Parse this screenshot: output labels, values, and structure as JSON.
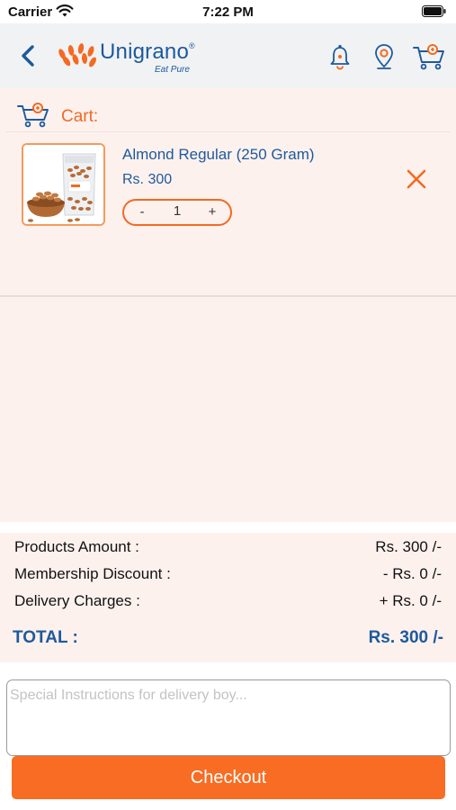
{
  "status_bar": {
    "carrier": "Carrier",
    "time": "7:22 PM"
  },
  "header": {
    "brand_name": "Unigrano",
    "brand_reg": "®",
    "brand_tagline": "Eat Pure",
    "icons": [
      "back-arrow-icon",
      "bell-icon",
      "location-pin-icon",
      "cart-icon"
    ]
  },
  "cart": {
    "title": "Cart:",
    "items": [
      {
        "name": "Almond Regular (250 Gram)",
        "price": "Rs. 300",
        "quantity": "1",
        "minus_label": "-",
        "plus_label": "+"
      }
    ]
  },
  "summary": {
    "products_amount_label": "Products Amount :",
    "products_amount_value": "Rs. 300 /-",
    "membership_discount_label": "Membership Discount :",
    "membership_discount_value": "- Rs. 0 /-",
    "delivery_charges_label": "Delivery Charges :",
    "delivery_charges_value": "+ Rs. 0 /-",
    "total_label": "TOTAL :",
    "total_value": "Rs. 300 /-"
  },
  "instructions": {
    "placeholder": "Special Instructions for delivery boy...",
    "value": ""
  },
  "checkout": {
    "label": "Checkout"
  },
  "colors": {
    "accent": "#f86c23",
    "brand_blue": "#1d5a9b",
    "panel_bg": "#fdf1ee",
    "header_bg": "#f1f2f4"
  }
}
